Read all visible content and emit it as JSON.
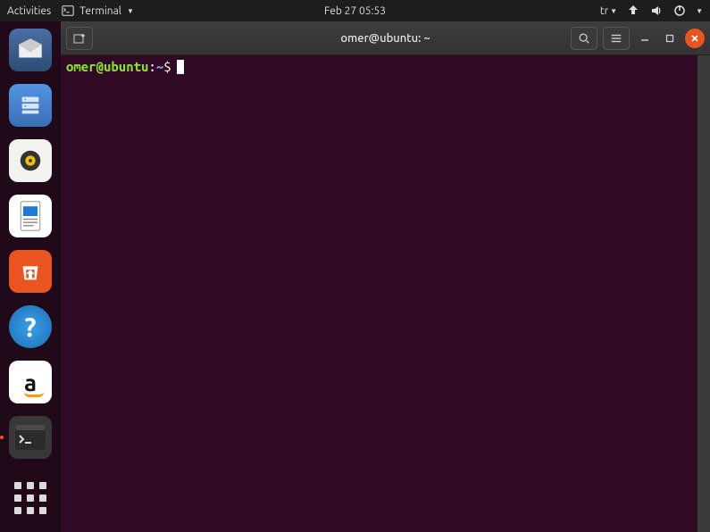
{
  "topBar": {
    "activities": "Activities",
    "appName": "Terminal",
    "clock": "Feb 27  05:53",
    "keyboard": "tr"
  },
  "dock": {
    "apps": [
      {
        "name": "thunderbird"
      },
      {
        "name": "files"
      },
      {
        "name": "rhythmbox"
      },
      {
        "name": "libreoffice-writer"
      },
      {
        "name": "ubuntu-software"
      },
      {
        "name": "help"
      },
      {
        "name": "amazon"
      },
      {
        "name": "terminal",
        "running": true
      }
    ]
  },
  "terminal": {
    "title": "omer@ubuntu: ~",
    "prompt": {
      "userHost": "omer@ubuntu",
      "colon": ":",
      "path": "~",
      "dollar": "$"
    }
  }
}
